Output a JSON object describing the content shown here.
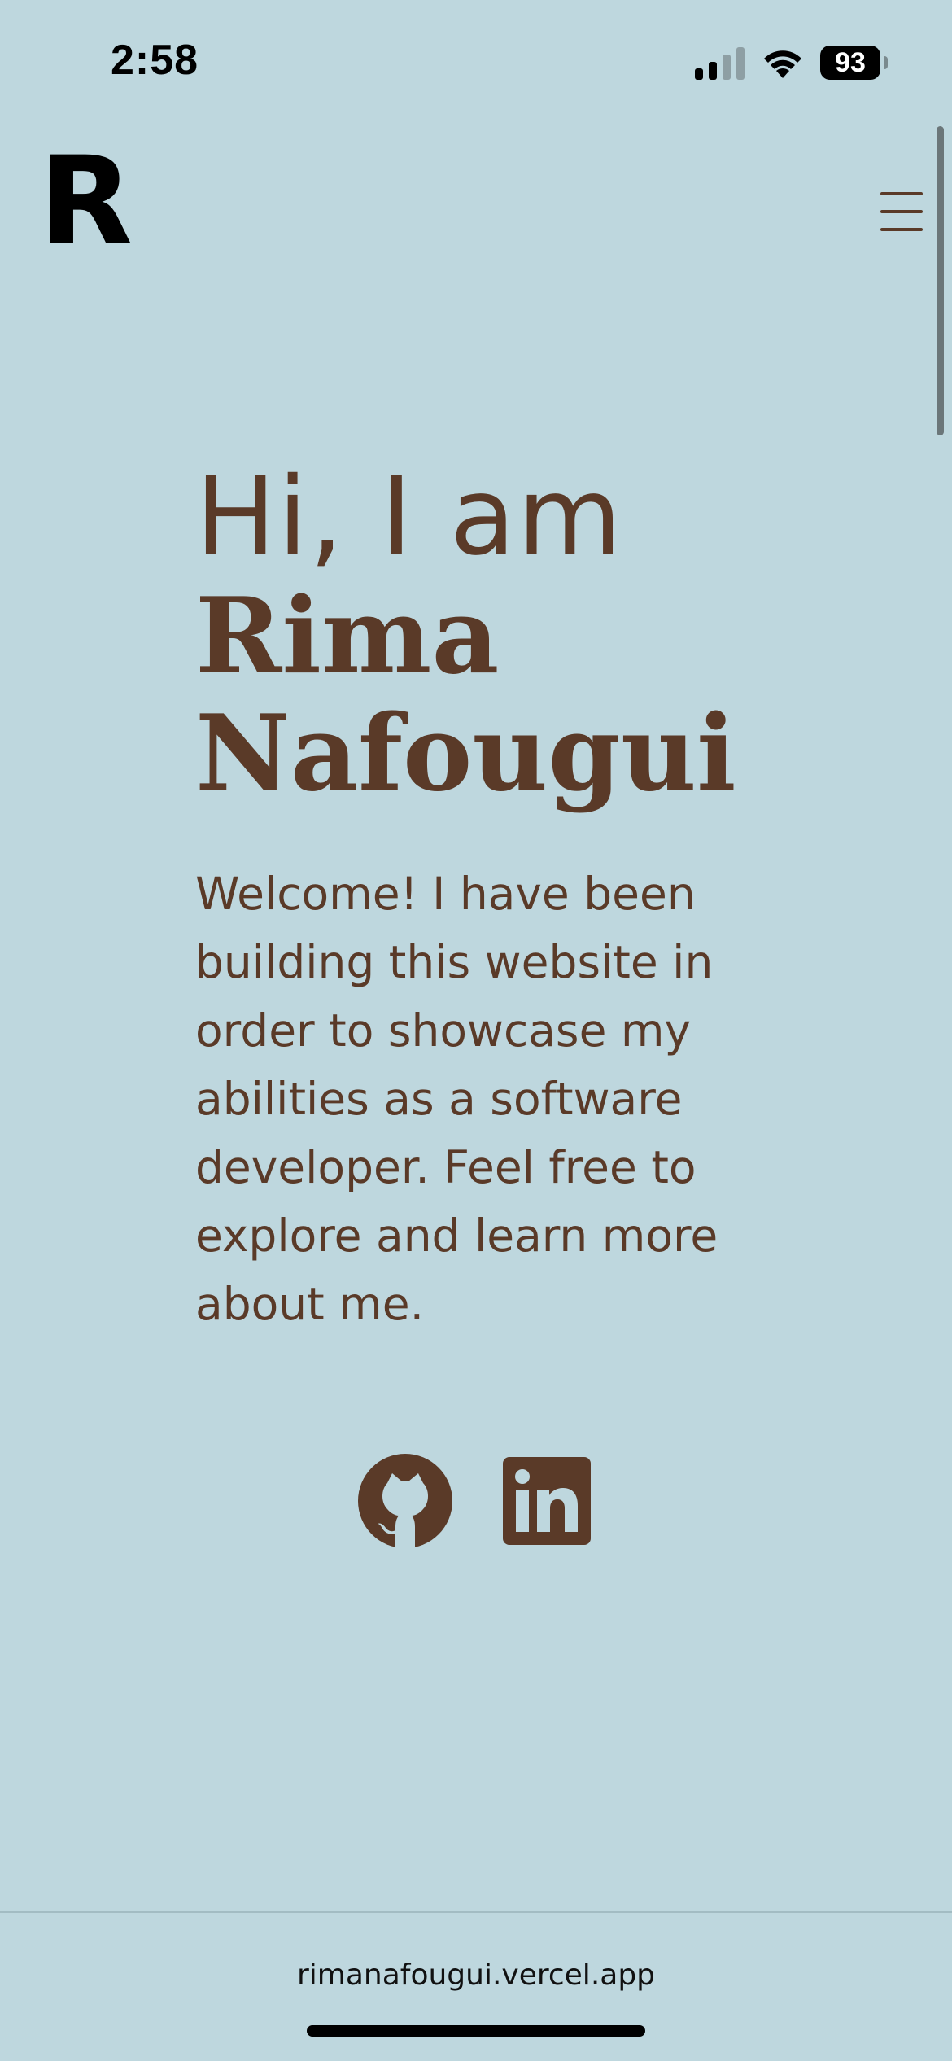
{
  "status_bar": {
    "time": "2:58",
    "battery": "93"
  },
  "header": {
    "logo": "R",
    "menu_icon": "hamburger-menu-icon"
  },
  "hero": {
    "greeting": "Hi, I am",
    "name_line1": "Rima",
    "name_line2": "Nafougui",
    "intro": "Welcome! I have been building this website in order to showcase my abilities as a software developer. Feel free to explore and learn more about me."
  },
  "social": {
    "items": [
      {
        "icon": "github-icon"
      },
      {
        "icon": "linkedin-icon"
      }
    ]
  },
  "browser": {
    "url": "rimanafougui.vercel.app"
  },
  "colors": {
    "background": "#bed7de",
    "accent": "#5a3a28"
  }
}
